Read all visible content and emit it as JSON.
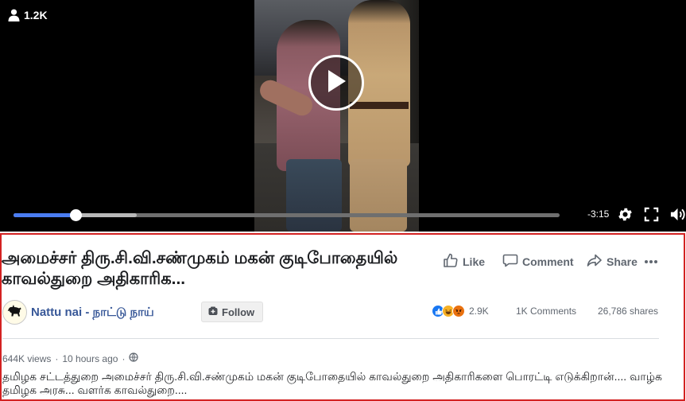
{
  "video": {
    "viewers": "1.2K",
    "time_remaining": "-3:15",
    "progress": {
      "played": 0.113,
      "buffered": 0.225
    }
  },
  "post": {
    "title": "அமைச்சர் திரு.சி.வி.சண்முகம் மகன் குடிபோதையில் காவல்துறை அதிகாரிக...",
    "actions": {
      "like": "Like",
      "comment": "Comment",
      "share": "Share"
    },
    "page_name": "Nattu nai - நாட்டு நாய்",
    "follow_label": "Follow",
    "reactions_count": "2.9K",
    "comments_count": "1K Comments",
    "shares_count": "26,786 shares",
    "views": "644K views",
    "separator": "·",
    "time_ago": "10 hours ago",
    "description": "தமிழக சட்டத்துறை அமைச்சர் திரு.சி.வி.சண்முகம் மகன் குடிபோதையில் காவல்துறை அதிகாரிகளை பொரட்டி எடுக்கிறான்.... வாழ்க தமிழக அரசு... வளர்க காவல்துறை....",
    "reaction_types": [
      "like-icon",
      "haha-icon",
      "angry-icon"
    ]
  },
  "colors": {
    "accent": "#4a7cf1",
    "link": "#385898",
    "highlight_border": "#d32222",
    "like": "#1877f2",
    "haha": "#f7b125",
    "angry": "#e9710f"
  }
}
